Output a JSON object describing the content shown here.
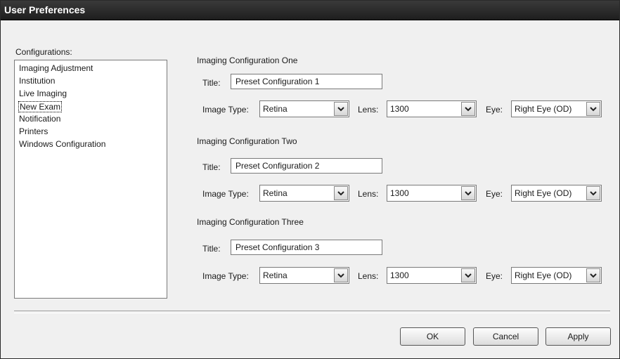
{
  "window": {
    "title": "User Preferences"
  },
  "sidebar": {
    "label": "Configurations:",
    "items": [
      {
        "label": "Imaging Adjustment"
      },
      {
        "label": "Institution"
      },
      {
        "label": "Live Imaging"
      },
      {
        "label": "New Exam",
        "selected": true
      },
      {
        "label": "Notification"
      },
      {
        "label": "Printers"
      },
      {
        "label": "Windows Configuration"
      }
    ]
  },
  "field_labels": {
    "title": "Title:",
    "image_type": "Image Type:",
    "lens": "Lens:",
    "eye": "Eye:"
  },
  "configs": [
    {
      "heading": "Imaging Configuration One",
      "title_value": "Preset Configuration 1",
      "image_type": "Retina",
      "lens": "1300",
      "eye": "Right Eye (OD)"
    },
    {
      "heading": "Imaging Configuration Two",
      "title_value": "Preset Configuration 2",
      "image_type": "Retina",
      "lens": "1300",
      "eye": "Right Eye (OD)"
    },
    {
      "heading": "Imaging Configuration Three",
      "title_value": "Preset Configuration 3",
      "image_type": "Retina",
      "lens": "1300",
      "eye": "Right Eye (OD)"
    }
  ],
  "buttons": {
    "ok": "OK",
    "cancel": "Cancel",
    "apply": "Apply"
  },
  "icons": {
    "dropdown": "chevron-down-icon"
  }
}
